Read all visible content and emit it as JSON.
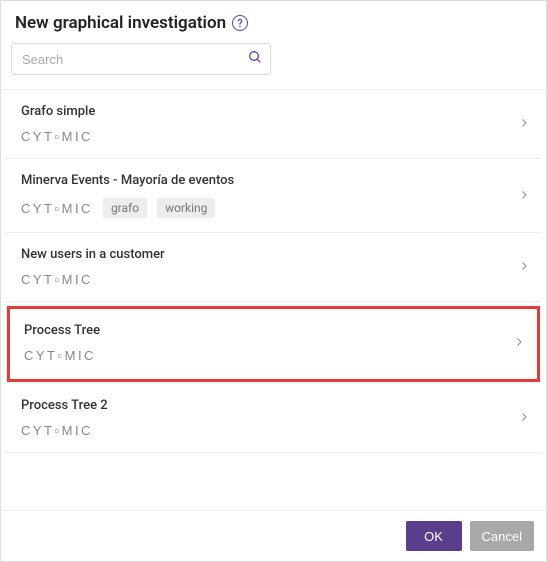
{
  "header": {
    "title": "New graphical investigation"
  },
  "search": {
    "placeholder": "Search"
  },
  "brand": "CYT▫MIC",
  "items": [
    {
      "title": "Grafo simple",
      "tags": [],
      "highlighted": false
    },
    {
      "title": "Minerva Events - Mayoría de eventos",
      "tags": [
        "grafo",
        "working"
      ],
      "highlighted": false
    },
    {
      "title": "New users in a customer",
      "tags": [],
      "highlighted": false
    },
    {
      "title": "Process Tree",
      "tags": [],
      "highlighted": true
    },
    {
      "title": "Process Tree 2",
      "tags": [],
      "highlighted": false
    }
  ],
  "footer": {
    "ok": "OK",
    "cancel": "Cancel"
  }
}
